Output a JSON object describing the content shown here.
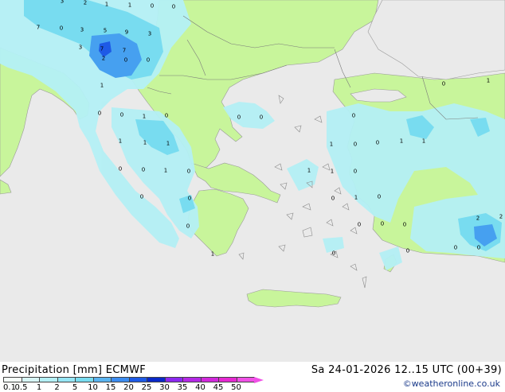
{
  "map": {
    "colors": {
      "sea": "#eaeaea",
      "land": "#c8f59b",
      "precip_light": "#b4f0f5",
      "precip_mid": "#78dcf0",
      "precip_heavy": "#46a0f0"
    },
    "point_labels": [
      "3",
      "2",
      "1",
      "1",
      "0",
      "0",
      "7",
      "0",
      "3",
      "5",
      "9",
      "3",
      "3",
      "7",
      "7",
      "2",
      "0",
      "0",
      "1",
      "0",
      "0",
      "1",
      "0",
      "1",
      "1",
      "1",
      "0",
      "0",
      "1",
      "0",
      "0",
      "0",
      "0",
      "1",
      "0",
      "0",
      "0",
      "1",
      "0",
      "0",
      "1",
      "1",
      "1",
      "1",
      "0",
      "0",
      "1",
      "0",
      "0",
      "0",
      "0",
      "0",
      "0",
      "0",
      "1",
      "2",
      "2",
      "0",
      "0"
    ]
  },
  "footer": {
    "title": "Precipitation [mm] ECMWF",
    "datetime": "Sa 24-01-2026 12..15 UTC (00+39)",
    "credit": "©weatheronline.co.uk",
    "scale": [
      {
        "label": "0.1",
        "color": "#f5fffa"
      },
      {
        "label": "0.5",
        "color": "#d7f5f5"
      },
      {
        "label": "1",
        "color": "#b4f0f5"
      },
      {
        "label": "2",
        "color": "#96e6f5"
      },
      {
        "label": "5",
        "color": "#78dcf0"
      },
      {
        "label": "10",
        "color": "#5ab4f0"
      },
      {
        "label": "15",
        "color": "#3c8cf0"
      },
      {
        "label": "20",
        "color": "#1e5ae6"
      },
      {
        "label": "25",
        "color": "#0a28c8"
      },
      {
        "label": "30",
        "color": "#8c28f0"
      },
      {
        "label": "35",
        "color": "#b428e6"
      },
      {
        "label": "40",
        "color": "#d228dc"
      },
      {
        "label": "45",
        "color": "#e628d2"
      },
      {
        "label": "50",
        "color": "#f050e6"
      }
    ]
  }
}
